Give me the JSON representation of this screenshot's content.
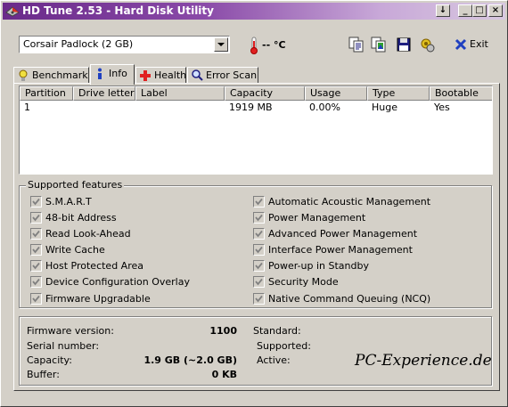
{
  "window": {
    "title": "HD Tune 2.53 - Hard Disk Utility",
    "buttons": {
      "scroll": "↓",
      "minimize": "_",
      "maximize": "□",
      "close": "×"
    }
  },
  "toolbar": {
    "drive": "Corsair Padlock (2 GB)",
    "temperature": "-- °C",
    "exit_label": "Exit",
    "icons": [
      "copy-text-icon",
      "copy-screenshot-icon",
      "save-icon",
      "options-icon",
      "exit-icon"
    ]
  },
  "tabs": [
    {
      "label": "Benchmark",
      "icon": "benchmark-icon"
    },
    {
      "label": "Info",
      "icon": "info-icon",
      "active": true
    },
    {
      "label": "Health",
      "icon": "health-icon"
    },
    {
      "label": "Error Scan",
      "icon": "error-scan-icon"
    }
  ],
  "partitions": {
    "columns": [
      "Partition",
      "Drive letter",
      "Label",
      "Capacity",
      "Usage",
      "Type",
      "Bootable"
    ],
    "rows": [
      {
        "partition": "1",
        "drive_letter": "",
        "label": "",
        "capacity": "1919 MB",
        "usage": "0.00%",
        "type": "Huge",
        "bootable": "Yes"
      }
    ]
  },
  "features": {
    "title": "Supported features",
    "left": [
      {
        "label": "S.M.A.R.T",
        "checked": true
      },
      {
        "label": "48-bit Address",
        "checked": true
      },
      {
        "label": "Read Look-Ahead",
        "checked": true
      },
      {
        "label": "Write Cache",
        "checked": true
      },
      {
        "label": "Host Protected Area",
        "checked": true
      },
      {
        "label": "Device Configuration Overlay",
        "checked": true
      },
      {
        "label": "Firmware Upgradable",
        "checked": true
      }
    ],
    "right": [
      {
        "label": "Automatic Acoustic Management",
        "checked": true
      },
      {
        "label": "Power Management",
        "checked": true
      },
      {
        "label": "Advanced Power Management",
        "checked": true
      },
      {
        "label": "Interface Power Management",
        "checked": true
      },
      {
        "label": "Power-up in Standby",
        "checked": true
      },
      {
        "label": "Security Mode",
        "checked": true
      },
      {
        "label": "Native Command Queuing (NCQ)",
        "checked": true
      }
    ]
  },
  "info": {
    "firmware_label": "Firmware version:",
    "firmware_value": "1100",
    "serial_label": "Serial number:",
    "serial_value": "",
    "capacity_label": "Capacity:",
    "capacity_value": "1.9 GB (~2.0 GB)",
    "buffer_label": "Buffer:",
    "buffer_value": "0 KB",
    "standard_label": "Standard:",
    "supported_label": "Supported:",
    "active_label": "Active:"
  },
  "watermark": "PC-Experience.de"
}
